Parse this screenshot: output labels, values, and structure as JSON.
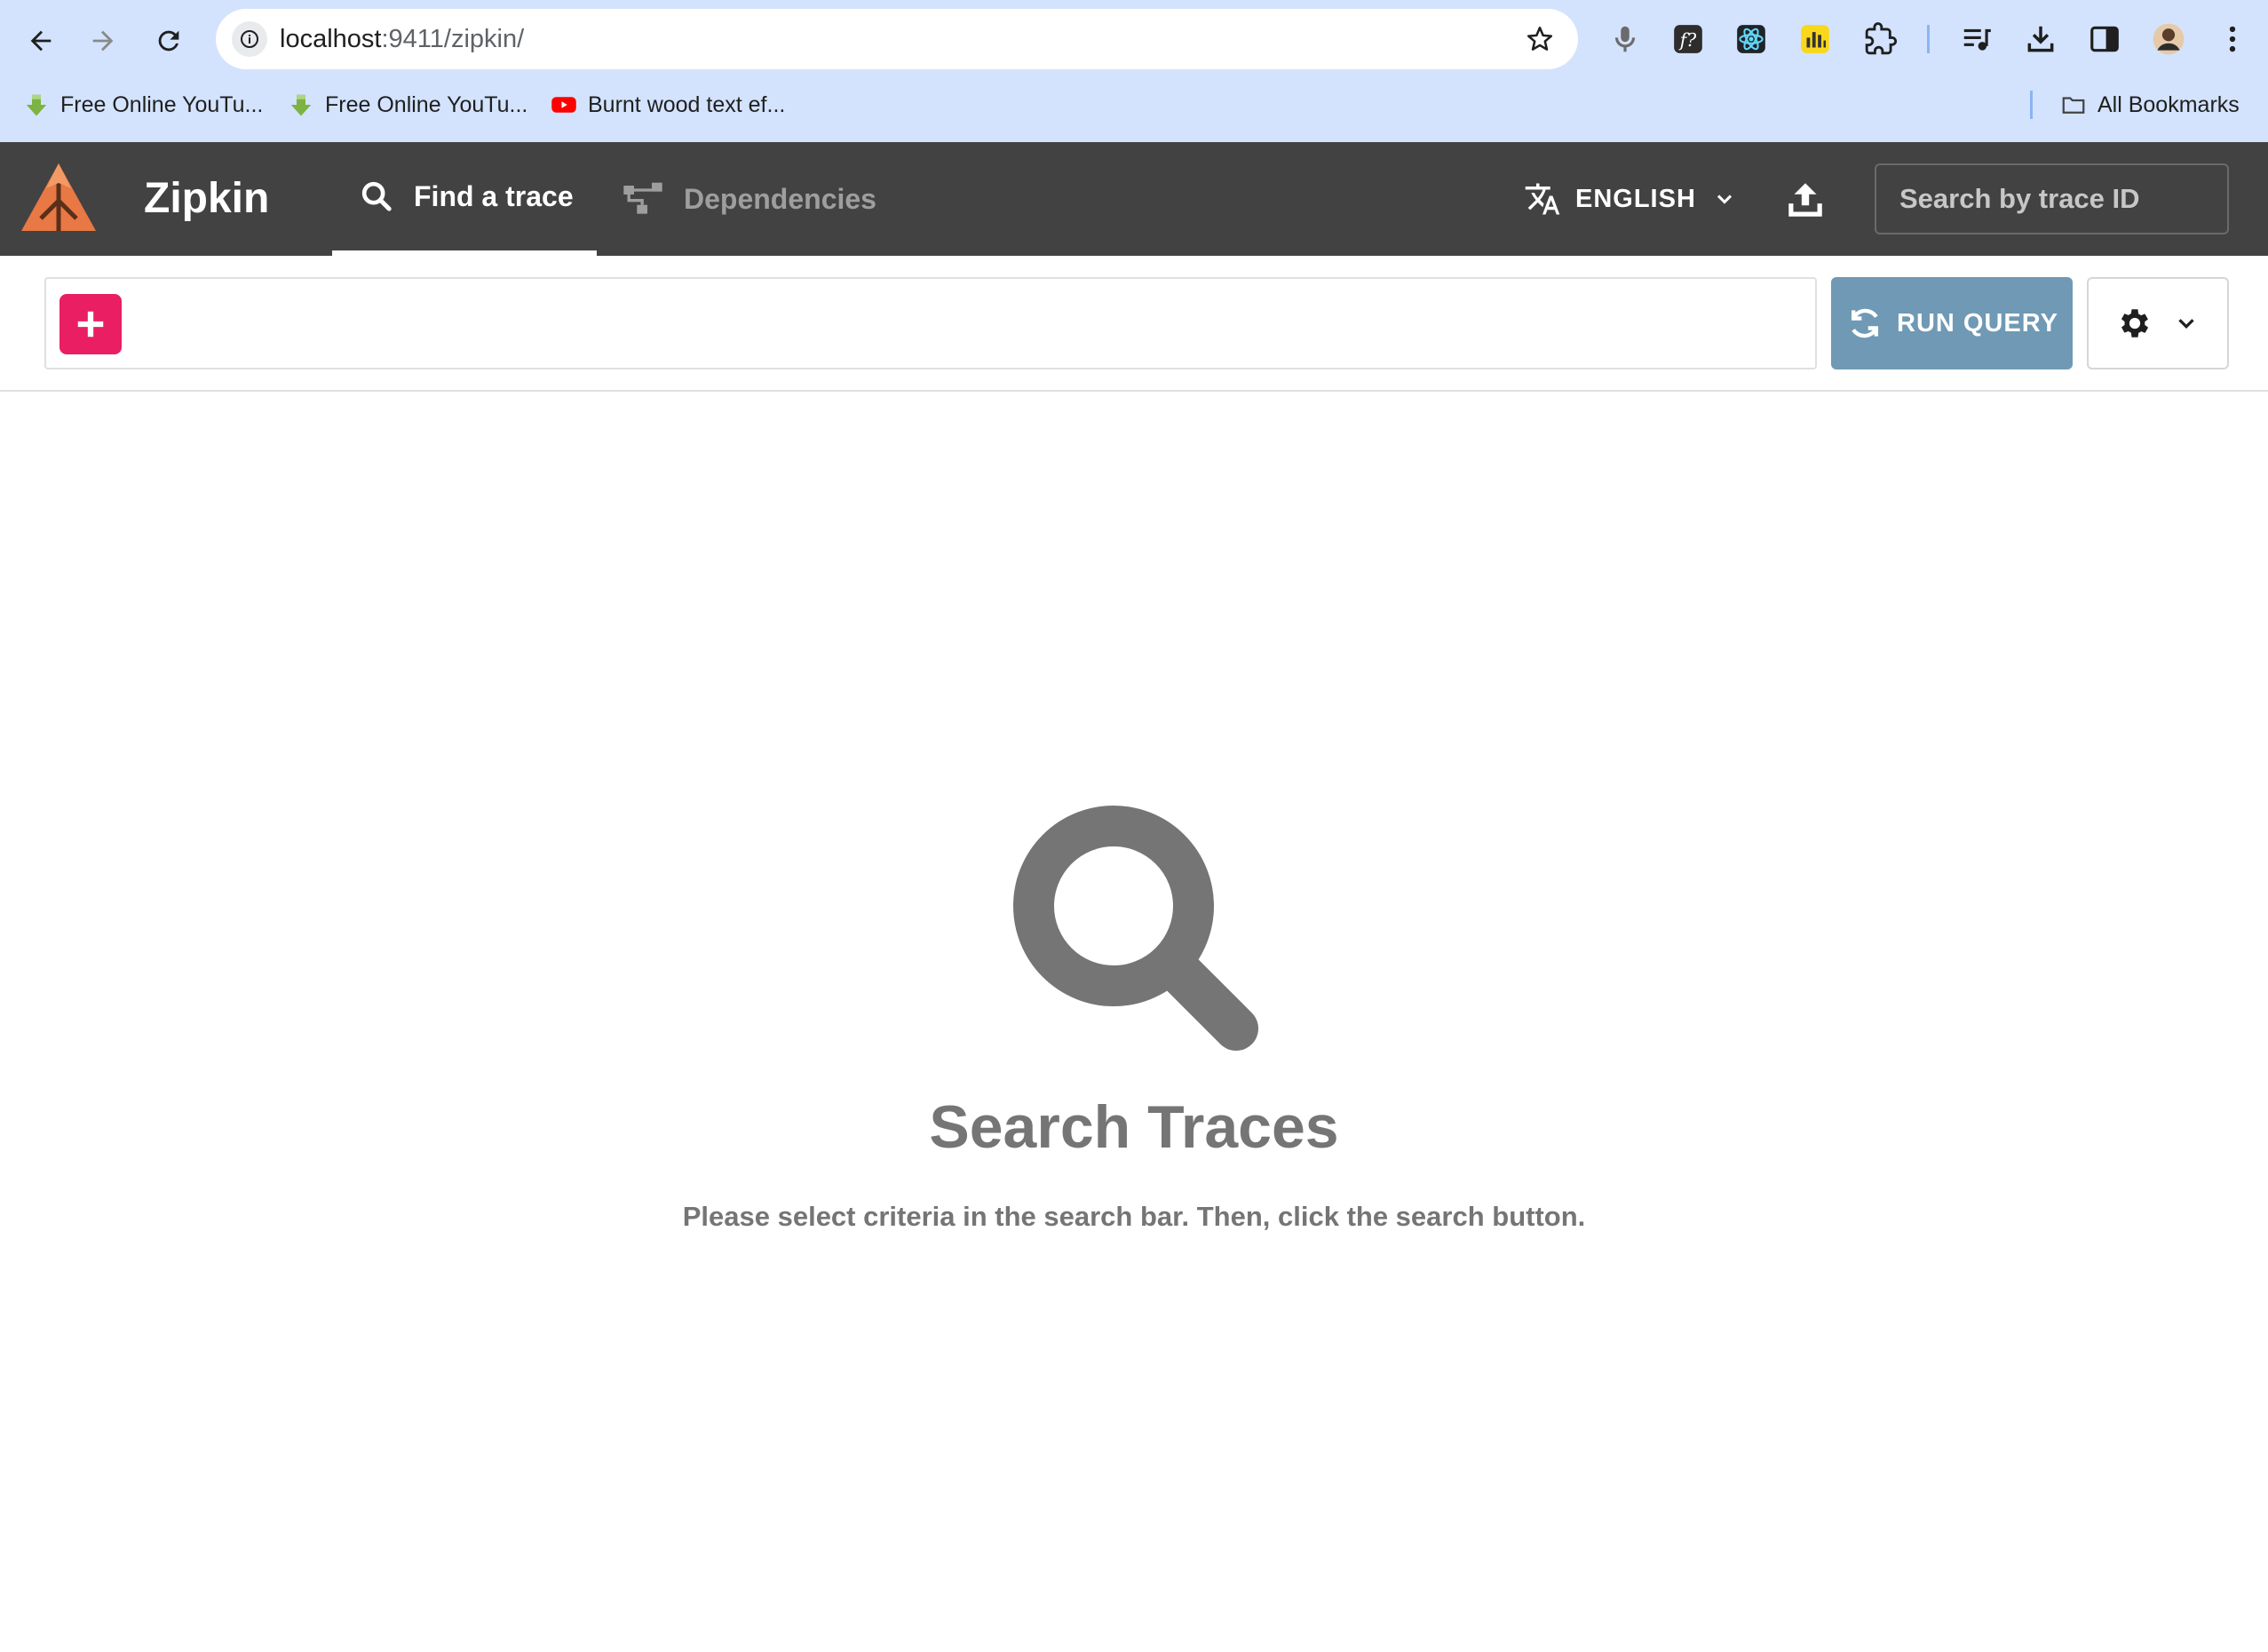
{
  "browser": {
    "url_host": "localhost",
    "url_path": ":9411/zipkin/",
    "bookmarks": [
      {
        "label": "Free Online YouTu...",
        "icon": "green-arrow-icon"
      },
      {
        "label": "Free Online YouTu...",
        "icon": "green-arrow-icon"
      },
      {
        "label": "Burnt wood text ef...",
        "icon": "youtube-icon"
      }
    ],
    "all_bookmarks_label": "All Bookmarks"
  },
  "app": {
    "brand": "Zipkin",
    "tabs": [
      {
        "label": "Find a trace",
        "icon": "search-icon",
        "active": true
      },
      {
        "label": "Dependencies",
        "icon": "dependencies-icon",
        "active": false
      }
    ],
    "language": "ENGLISH",
    "trace_search_placeholder": "Search by trace ID",
    "accent_color": "#e91e63",
    "header_color": "#424242"
  },
  "query_bar": {
    "run_query_label": "RUN QUERY"
  },
  "empty_state": {
    "title": "Search Traces",
    "description": "Please select criteria in the search bar. Then, click the search button."
  }
}
